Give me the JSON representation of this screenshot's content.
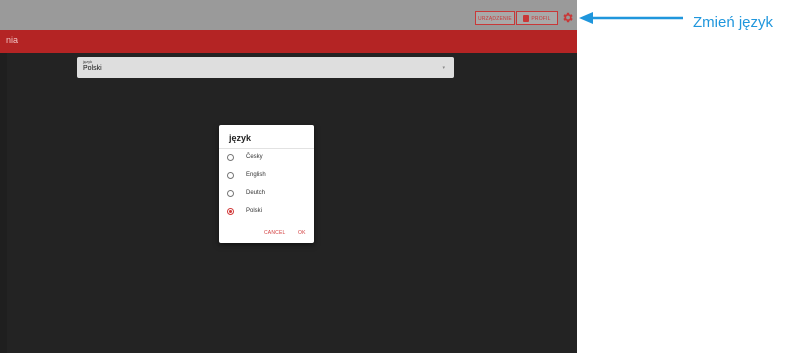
{
  "header": {
    "device_button": "URZĄDZENIE",
    "profile_button": "PROFIL"
  },
  "redbar": {
    "title": "nia"
  },
  "language_field": {
    "label": "język",
    "value": "Polski"
  },
  "dialog": {
    "title": "język",
    "options": [
      {
        "label": "Česky",
        "selected": false
      },
      {
        "label": "English",
        "selected": false
      },
      {
        "label": "Deutch",
        "selected": false
      },
      {
        "label": "Polski",
        "selected": true
      }
    ],
    "cancel": "CANCEL",
    "ok": "OK"
  },
  "annotation": {
    "label": "Zmień język"
  },
  "colors": {
    "accent": "#b42424",
    "annotation": "#1f96dc",
    "radio_selected": "#d23b3b"
  },
  "icons": {
    "settings": "gear-icon",
    "profile": "profile-icon"
  }
}
